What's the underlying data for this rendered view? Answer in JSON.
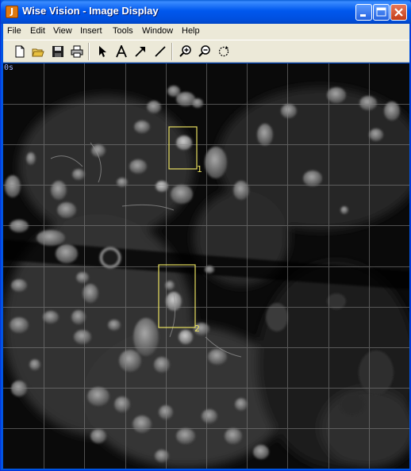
{
  "window": {
    "title": "Wise Vision - Image Display",
    "app_icon_glyph": "J"
  },
  "menu": [
    {
      "label": "File"
    },
    {
      "label": "Edit"
    },
    {
      "label": "View"
    },
    {
      "label": "Insert"
    },
    {
      "label": "Tools"
    },
    {
      "label": "Window"
    },
    {
      "label": "Help"
    }
  ],
  "toolbar": {
    "tools": [
      "new-file-icon",
      "open-folder-icon",
      "save-icon",
      "print-icon",
      "pointer-icon",
      "text-icon",
      "arrow-icon",
      "line-icon",
      "zoom-in-icon",
      "zoom-out-icon",
      "rotate-icon"
    ]
  },
  "image": {
    "frame_label": "0s",
    "rois": [
      {
        "label": "1"
      },
      {
        "label": "2"
      }
    ],
    "roi_color": "#e8e060",
    "grid_color": "#8a8a8a"
  }
}
